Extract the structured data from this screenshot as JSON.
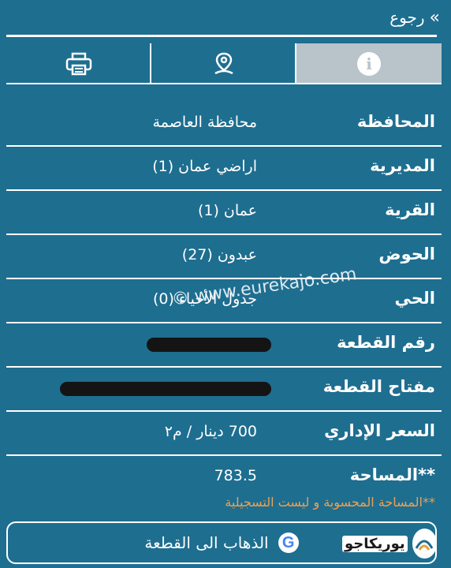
{
  "header": {
    "back_label": "رجوع",
    "back_icon": "double-chevron-icon"
  },
  "tabs": [
    {
      "icon": "info-icon",
      "active": true
    },
    {
      "icon": "location-pin-icon",
      "active": false
    },
    {
      "icon": "printer-icon",
      "active": false
    }
  ],
  "details": [
    {
      "label": "المحافظة",
      "value": "محافظة العاصمة"
    },
    {
      "label": "المديرية",
      "value": "اراضي عمان (1)"
    },
    {
      "label": "القرية",
      "value": "عمان (1)"
    },
    {
      "label": "الحوض",
      "value": "عبدون (27)"
    },
    {
      "label": "الحي",
      "value": "جدول الأحياء (0)"
    },
    {
      "label": "رقم القطعة",
      "value": ""
    },
    {
      "label": "مفتاح القطعة",
      "value": ""
    },
    {
      "label": "السعر الإداري",
      "value": "700 دينار / م٢"
    },
    {
      "label": "**المساحة",
      "value": "783.5"
    }
  ],
  "watermark": "© www.eurekajo.com",
  "note": "**المساحة المحسوبة و ليست التسجيلية",
  "go_button": {
    "label": "الذهاب الى القطعة",
    "icon": "google-icon",
    "icon_letter": "G"
  },
  "brand": {
    "name": "يوريكاجو"
  },
  "colors": {
    "background": "#1e6e90",
    "active_tab": "#b8c4ca",
    "note": "#f0a050",
    "redaction": "#141414"
  }
}
